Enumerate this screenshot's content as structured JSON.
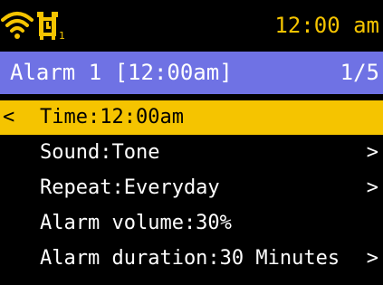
{
  "status_bar": {
    "wifi_icon": "wifi-icon",
    "alarm_icon": "alarm-1-icon",
    "alarm_icon_subscript": "1",
    "clock": "12:00 am"
  },
  "header": {
    "title": "Alarm 1 [12:00am]",
    "page": "1/5"
  },
  "menu": {
    "items": [
      {
        "label": "Time:12:00am",
        "selected": true,
        "leading": "<",
        "trailing": ""
      },
      {
        "label": "Sound:Tone",
        "selected": false,
        "leading": "",
        "trailing": ">"
      },
      {
        "label": "Repeat:Everyday",
        "selected": false,
        "leading": "",
        "trailing": ">"
      },
      {
        "label": "Alarm volume:30%",
        "selected": false,
        "leading": "",
        "trailing": ""
      },
      {
        "label": "Alarm duration:30 Minutes",
        "selected": false,
        "leading": "",
        "trailing": ">"
      }
    ]
  },
  "colors": {
    "background": "#000000",
    "accent_yellow": "#f5c400",
    "header_blue": "#6f72e4",
    "text": "#ffffff"
  }
}
